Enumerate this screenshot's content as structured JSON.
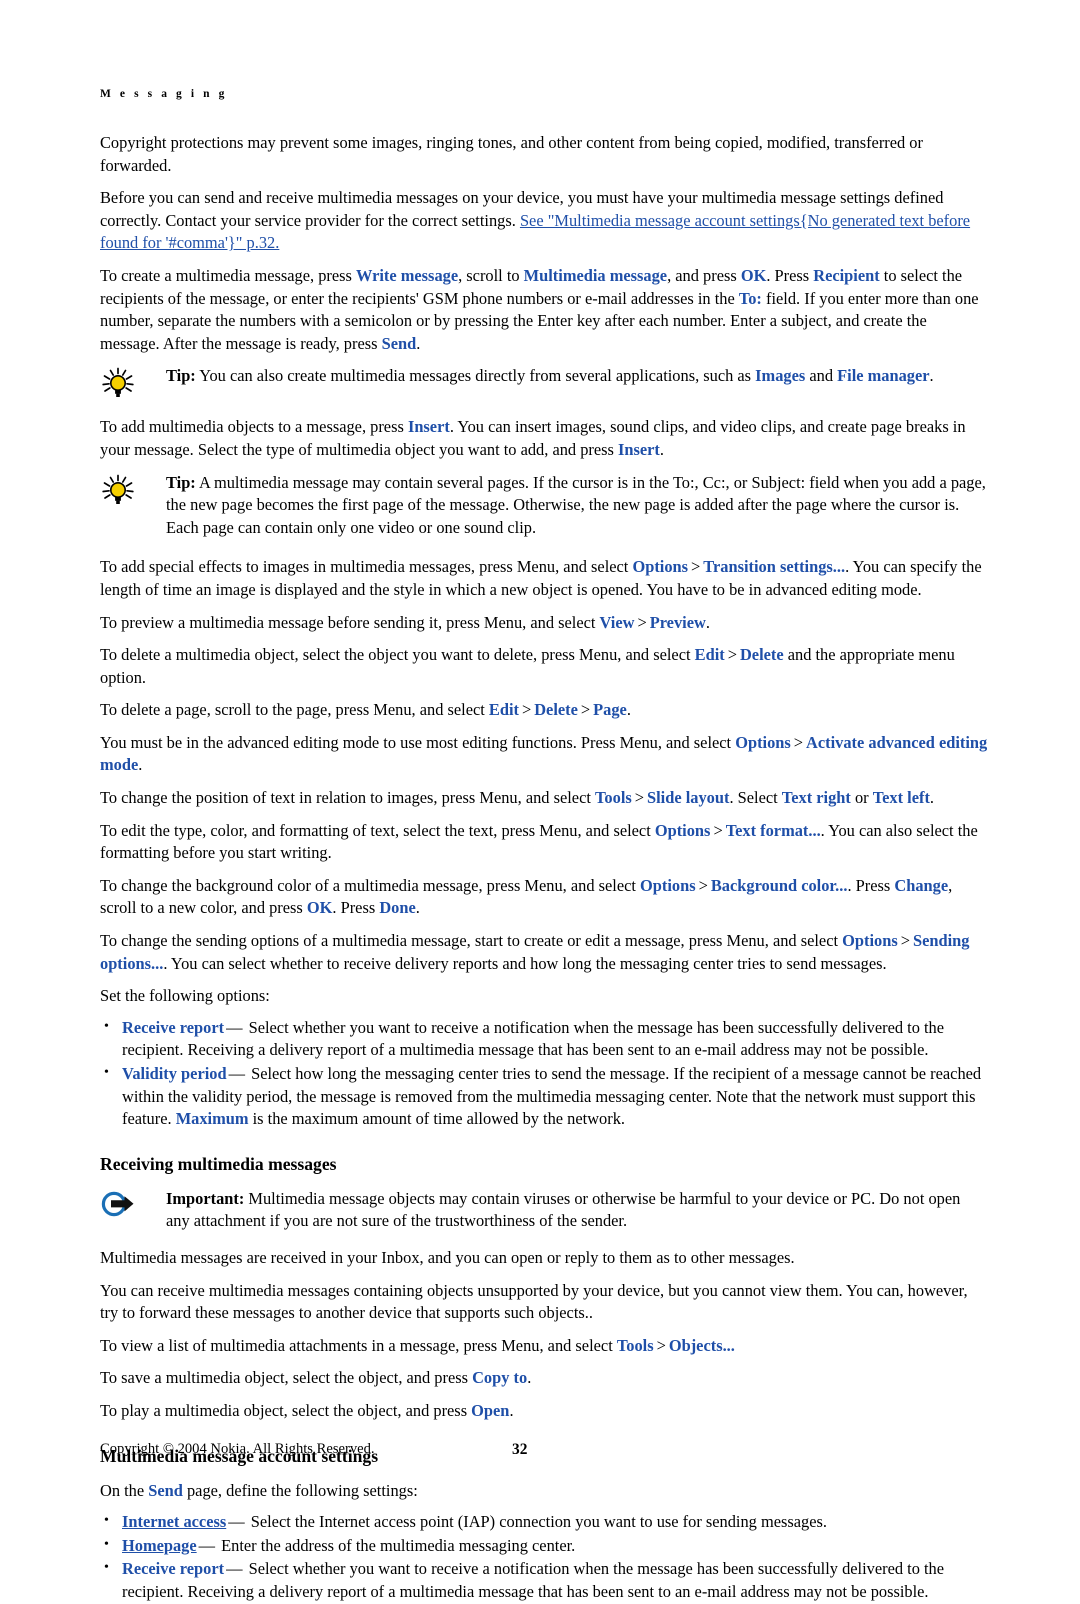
{
  "document": {
    "running_head": "M e s s a g i n g",
    "accent_blue": "#1f4fa8",
    "tip_bulb_color": "#f5cf00",
    "important_circle_color": "#1a6fb5"
  },
  "paragraphs": {
    "copyright_protections": "Copyright protections may prevent some images, ringing tones, and other content from being copied, modified, transferred or forwarded.",
    "before_you_can_send_a": "Before you can send and receive multimedia messages on your device, you must have your multimedia message settings defined correctly. Contact your service provider for the correct settings.",
    "before_you_can_send_link": "See \"Multimedia message account settings{No generated text before found for '#comma'}\" p.32.",
    "to_create_1": "To create a multimedia message, press ",
    "to_create_link1": "Write message",
    "to_create_2": ", scroll to ",
    "to_create_link2": "Multimedia message",
    "to_create_3": ", and press ",
    "to_create_link3": "OK",
    "to_create_4": ". Press ",
    "to_create_link4": "Recipient",
    "to_create_5": " to select the recipients of the message, or enter the recipients' GSM phone numbers or e-mail addresses in the ",
    "to_create_link5": "To:",
    "to_create_6": " field. If you enter more than one number, separate the numbers with a semicolon or by pressing the Enter key after each number. Enter a subject, and create the message. After the message is ready, press ",
    "to_create_link6": "Send",
    "to_create_7": ".",
    "tip1_lead": "Tip:",
    "tip1_a": " You can also create multimedia messages directly from several applications, such as ",
    "tip1_link1": "Images",
    "tip1_b": " and ",
    "tip1_link2": "File manager",
    "tip1_c": ".",
    "to_add_objects_1": "To add multimedia objects to a message, press ",
    "to_add_objects_link1": "Insert",
    "to_add_objects_2": ". You can insert images, sound clips, and video clips, and create page breaks in your message. Select the type of multimedia object you want to add, and press ",
    "to_add_objects_link2": "Insert",
    "to_add_objects_3": ".",
    "tip2_lead": "Tip:",
    "tip2_body": " A multimedia message may contain several pages. If the cursor is in the To:, Cc:, or Subject: field when you add a page, the new page becomes the first page of the message. Otherwise, the new page is added after the page where the cursor is. Each page can contain only one video or one sound clip.",
    "special_effects_1": "To add special effects to images in multimedia messages, press Menu, and select ",
    "special_effects_link1": "Options",
    "special_effects_link2": "Transition settings...",
    "special_effects_2": ". You can specify the length of time an image is displayed and the style in which a new object is opened. You have to be in advanced editing mode.",
    "preview_1": "To preview a multimedia message before sending it, press Menu, and select ",
    "preview_link1": "View",
    "preview_link2": "Preview",
    "preview_2": ".",
    "delete_object_1": "To delete a multimedia object, select the object you want to delete, press Menu, and select ",
    "delete_object_link1": "Edit",
    "delete_object_link2": "Delete",
    "delete_object_2": " and the appropriate menu option.",
    "delete_page_1": "To delete a page, scroll to the page, press Menu, and select ",
    "delete_page_link1": "Edit",
    "delete_page_link2": "Delete",
    "delete_page_link3": "Page",
    "delete_page_2": ".",
    "advanced_mode_1": "You must be in the advanced editing mode to use most editing functions. Press Menu, and select ",
    "advanced_mode_link1": "Options",
    "advanced_mode_link2": "Activate advanced editing mode",
    "advanced_mode_2": ".",
    "slide_layout_1": "To change the position of text in relation to images, press Menu, and select ",
    "slide_layout_link1": "Tools",
    "slide_layout_link2": "Slide layout",
    "slide_layout_2": ". Select ",
    "slide_layout_link3": "Text right",
    "slide_layout_3": " or ",
    "slide_layout_link4": "Text left",
    "slide_layout_4": ".",
    "text_format_1": "To edit the type, color, and formatting of text, select the text, press Menu, and select ",
    "text_format_link1": "Options",
    "text_format_link2": "Text format...",
    "text_format_2": ". You can also select the formatting before you start writing.",
    "background_1": "To change the background color of a multimedia message, press Menu, and select ",
    "background_link1": "Options",
    "background_link2": "Background color...",
    "background_2": ". Press ",
    "background_link3": "Change",
    "background_3": ", scroll to a new color, and press ",
    "background_link4": "OK",
    "background_4": ". Press ",
    "background_link5": "Done",
    "background_5": ".",
    "sending_options_1": "To change the sending options of a multimedia message, start to create or edit a message, press Menu, and select ",
    "sending_options_link1": "Options",
    "sending_options_link2": "Sending options...",
    "sending_options_2": ". You can select whether to receive delivery reports and how long the messaging center tries to send messages.",
    "set_following": "Set the following options:",
    "received_in_inbox": "Multimedia messages are received in your Inbox, and you can open or reply to them as to other messages.",
    "unsupported_objects": "You can receive multimedia messages containing objects unsupported by your device, but you cannot view them. You can, however, try to forward these messages to another device that supports such objects..",
    "view_list_1": "To view a list of multimedia attachments in a message, press Menu, and select ",
    "view_list_link1": "Tools",
    "view_list_link2": "Objects...",
    "save_object_1": "To save a multimedia object, select the object, and press ",
    "save_object_link1": "Copy to",
    "save_object_2": ".",
    "play_object_1": "To play a multimedia object, select the object, and press ",
    "play_object_link1": "Open",
    "play_object_2": ".",
    "on_send_page_1": "On the ",
    "on_send_page_link1": "Send",
    "on_send_page_2": " page, define the following settings:",
    "important_lead": "Important:",
    "important_body": " Multimedia message objects may contain viruses or otherwise be harmful to your device or PC. Do not open any attachment if you are not sure of the trustworthiness of the sender."
  },
  "sections": {
    "receiving": "Receiving multimedia messages",
    "account_settings": "Multimedia message account settings"
  },
  "sending_option_bullets": [
    {
      "term": "Receive report",
      "dash": "—",
      "text": " Select whether you want to receive a notification when the message has been successfully delivered to the recipient. Receiving a delivery report of a multimedia message that has been sent to an e-mail address may not be possible."
    },
    {
      "term": "Validity period",
      "dash": "—",
      "text_before_max": " Select how long the messaging center tries to send the message. If the recipient of a message cannot be reached within the validity period, the message is removed from the multimedia messaging center. Note that the network must support this feature. ",
      "max_term": "Maximum",
      "text_after_max": " is the maximum amount of time allowed by the network."
    }
  ],
  "account_setting_bullets": [
    {
      "term": "Internet access",
      "dash": "—",
      "text": " Select the Internet access point (IAP) connection you want to use for sending messages."
    },
    {
      "term": "Homepage",
      "dash": "—",
      "text": " Enter the address of the multimedia messaging center."
    },
    {
      "term": "Receive report",
      "dash": "—",
      "text": " Select whether you want to receive a notification when the message has been successfully delivered to the recipient. Receiving a delivery report of a multimedia message that has been sent to an e-mail address may not be possible."
    }
  ],
  "footer": {
    "copyright": "Copyright © 2004 Nokia. All Rights Reserved.",
    "page_number": "32"
  },
  "icons": {
    "tip": "lightbulb-icon",
    "important": "arrow-circle-icon"
  }
}
